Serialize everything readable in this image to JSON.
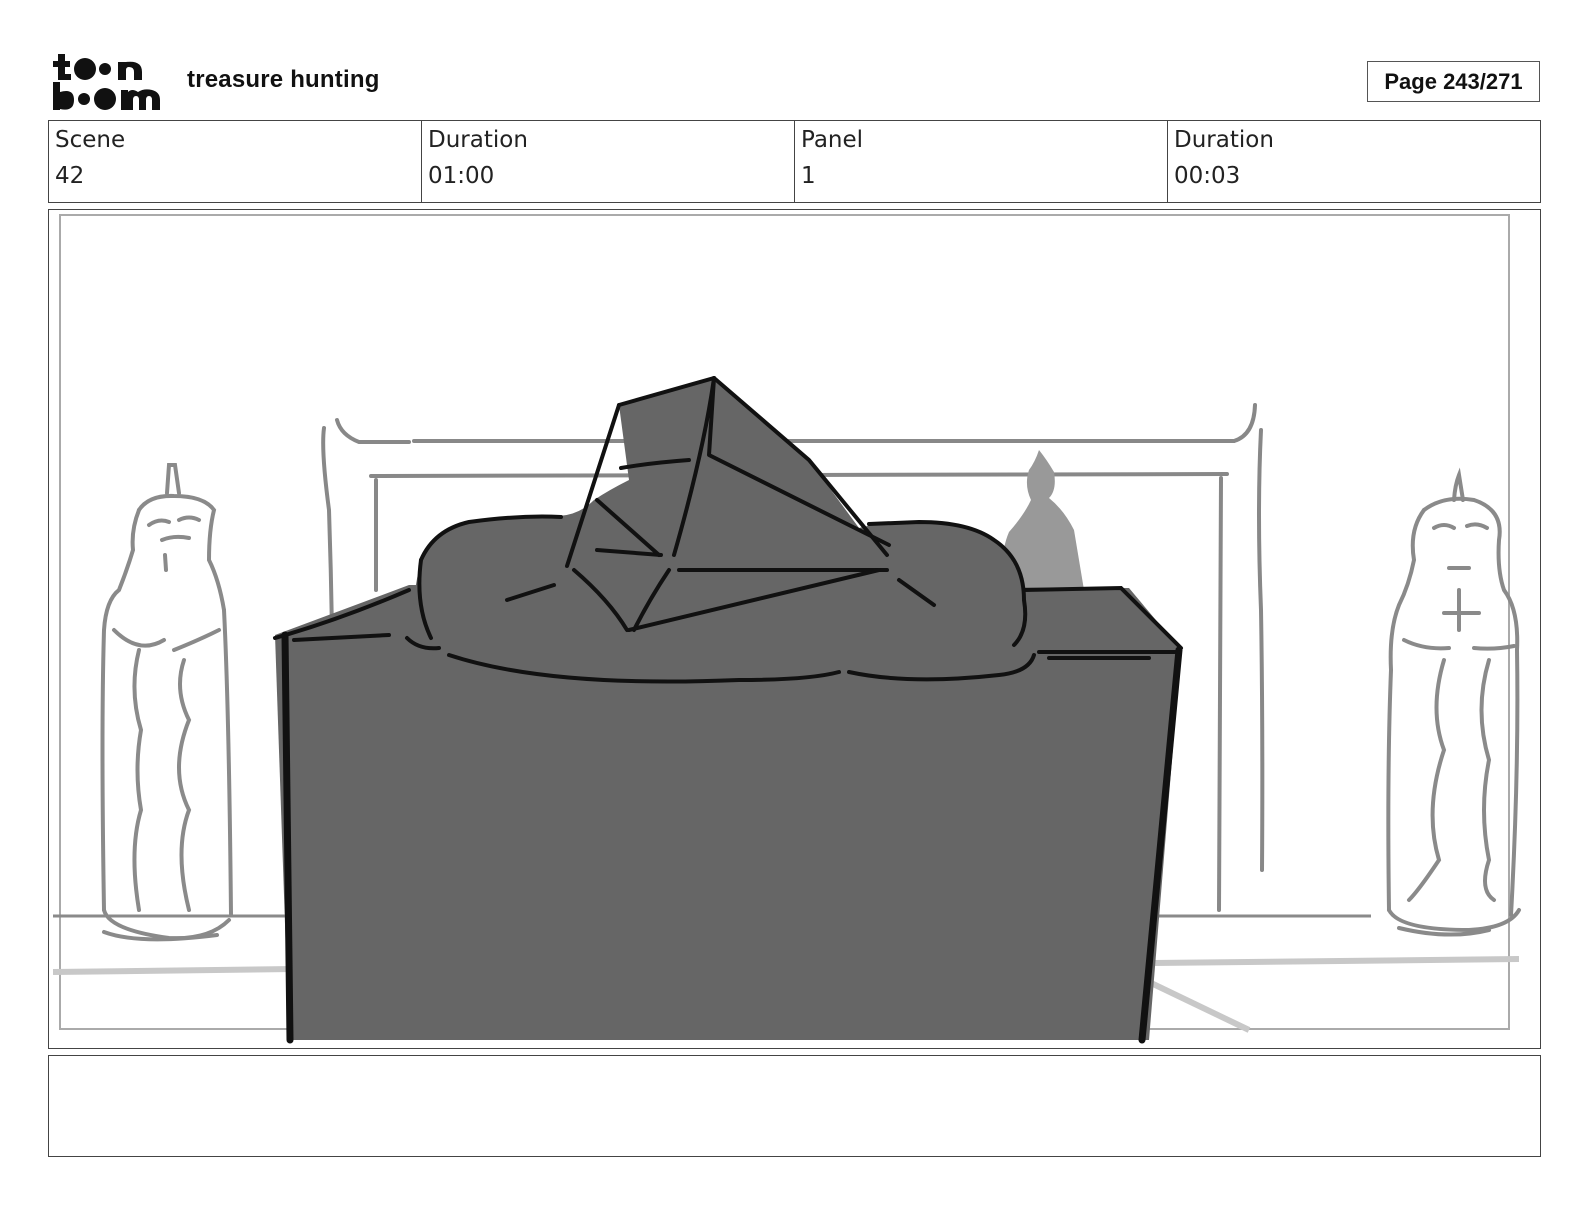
{
  "header": {
    "logo_text": "toon boom",
    "project_title": "treasure hunting",
    "page_label": "Page 243/271"
  },
  "info": [
    {
      "label": "Scene",
      "value": "42"
    },
    {
      "label": "Duration",
      "value": "01:00"
    },
    {
      "label": "Panel",
      "value": "1"
    },
    {
      "label": "Duration",
      "value": "00:03"
    }
  ],
  "panel": {
    "description": "",
    "colors": {
      "dark_fill": "#666666",
      "mid_fill": "#999999",
      "line_gray": "#8a8a8a",
      "ink": "#111111"
    }
  },
  "notes": {
    "text": ""
  }
}
